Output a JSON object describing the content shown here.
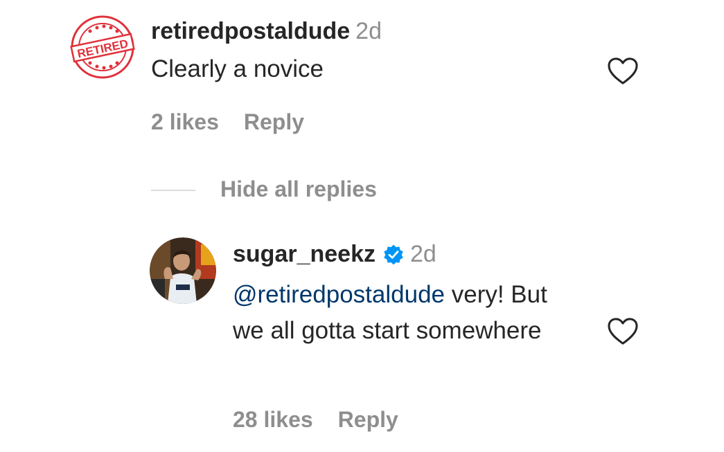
{
  "comments": [
    {
      "username": "retiredpostaldude",
      "time": "2d",
      "text": "Clearly a novice",
      "likes": "2 likes",
      "reply_label": "Reply",
      "avatar_stamp_text": "RETIRED"
    }
  ],
  "replies_toggle": {
    "label": "Hide all replies"
  },
  "replies": [
    {
      "username": "sugar_neekz",
      "verified": true,
      "time": "2d",
      "mention": "@retiredpostaldude",
      "text": " very! But we all gotta start somewhere",
      "likes": "28 likes",
      "reply_label": "Reply"
    }
  ],
  "colors": {
    "text_primary": "#262626",
    "text_secondary": "#8e8e8e",
    "mention": "#00376b",
    "verified_badge": "#0095f6",
    "stamp_red": "#e0313b"
  },
  "icons": {
    "like": "heart-outline-icon",
    "verified": "verified-badge-icon"
  }
}
